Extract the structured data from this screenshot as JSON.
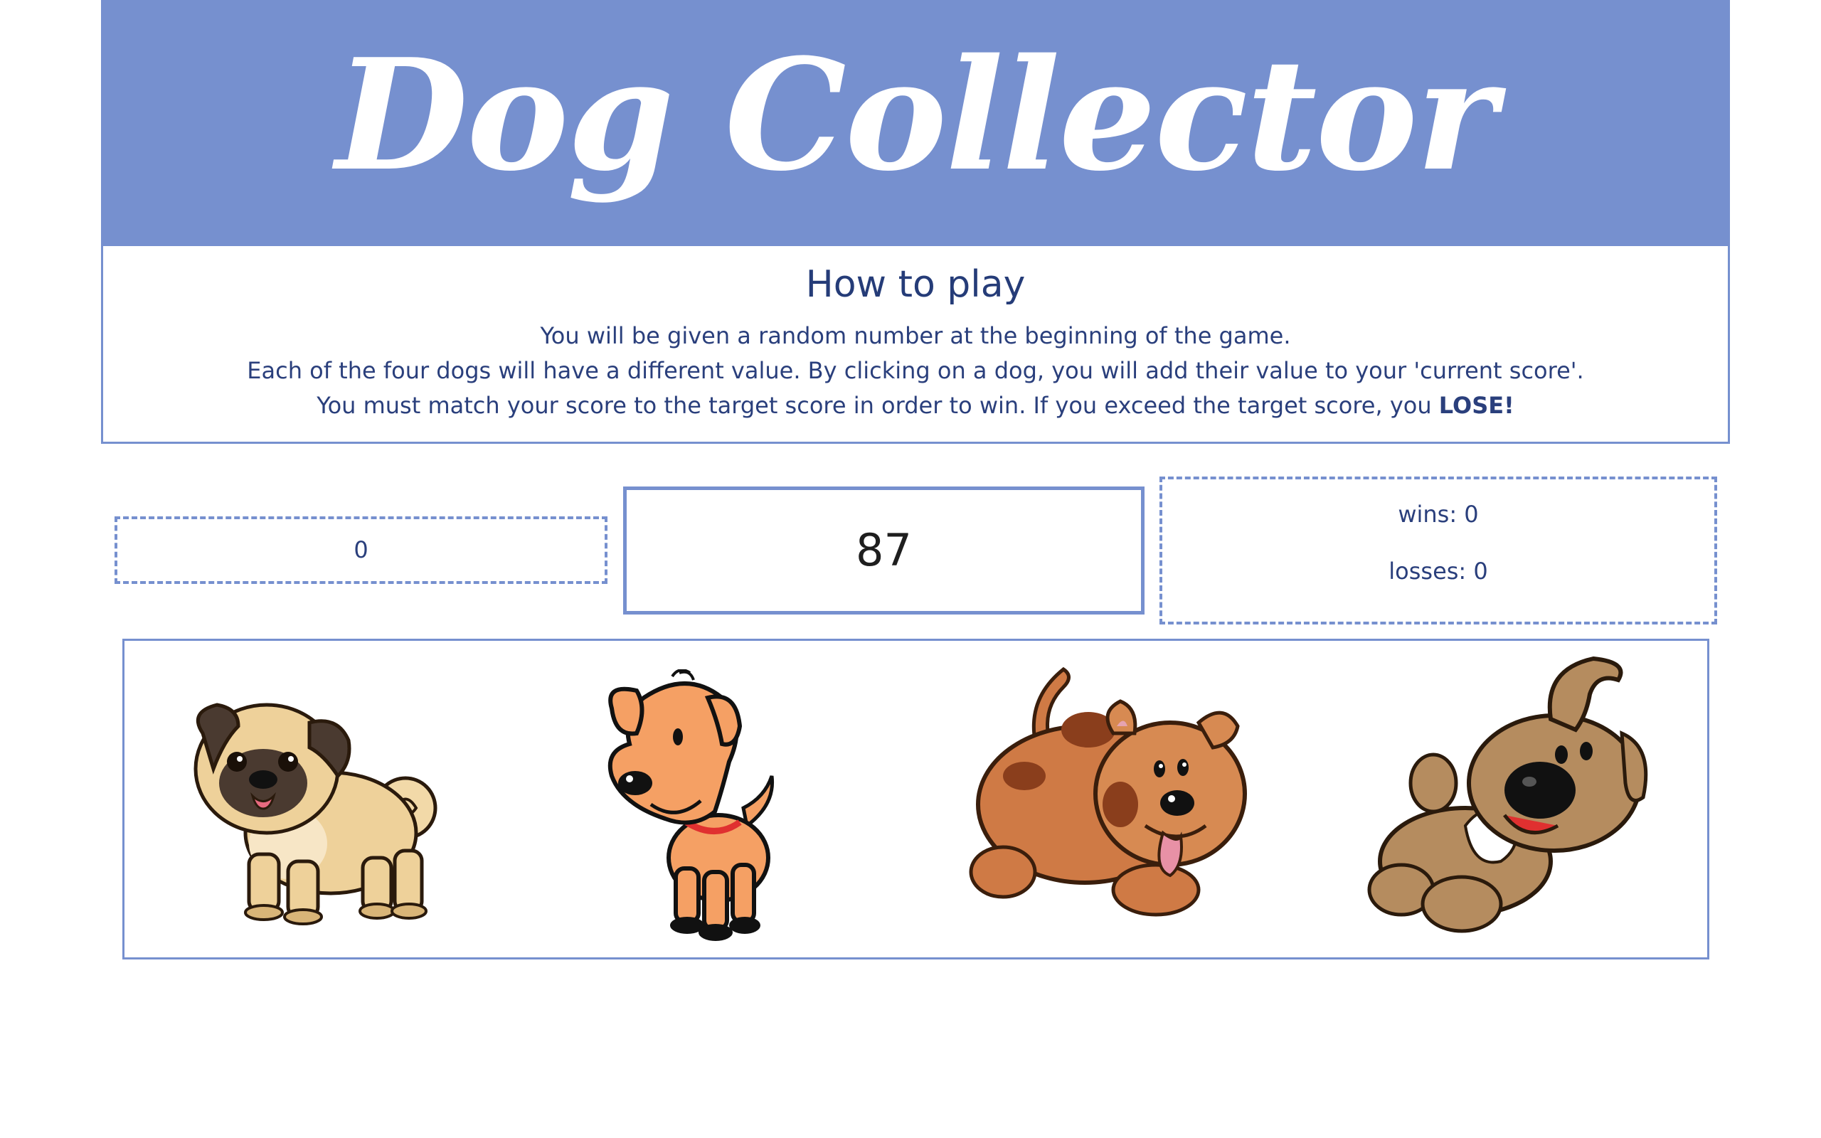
{
  "header": {
    "title": "Dog Collector"
  },
  "instructions": {
    "heading": "How to play",
    "line1": "You will be given a random number at the beginning of the game.",
    "line2": "Each of the four dogs will have a different value. By clicking on a dog, you will add their value to your 'current score'.",
    "line3_prefix": "You must match your score to the target score in order to win. If you exceed the target score, you ",
    "line3_emphasis": "LOSE!"
  },
  "game": {
    "current_score": "0",
    "target_score": "87",
    "wins_label": "wins: 0",
    "losses_label": "losses: 0"
  },
  "dogs": [
    {
      "icon": "pug-dog-icon"
    },
    {
      "icon": "orange-puppy-icon"
    },
    {
      "icon": "spotted-brown-dog-icon"
    },
    {
      "icon": "scruffy-brown-dog-icon"
    }
  ],
  "colors": {
    "accent": "#7690cf",
    "text": "#2a3f7c"
  }
}
